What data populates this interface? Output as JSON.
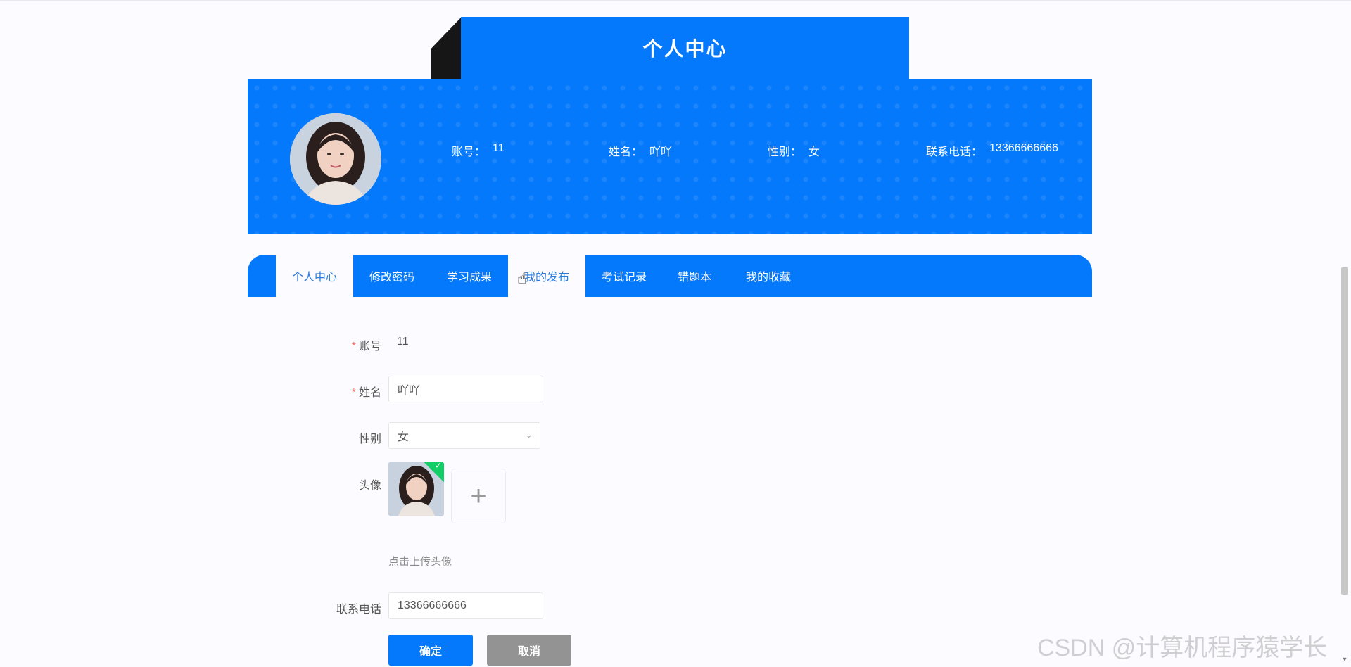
{
  "page": {
    "title": "个人中心"
  },
  "profile": {
    "items": [
      {
        "key": "账号：",
        "value": "11"
      },
      {
        "key": "姓名：",
        "value": "吖吖"
      },
      {
        "key": "性别：",
        "value": "女"
      },
      {
        "key": "联系电话：",
        "value": "13366666666"
      }
    ]
  },
  "tabs": [
    "个人中心",
    "修改密码",
    "学习成果",
    "我的发布",
    "考试记录",
    "错题本",
    "我的收藏"
  ],
  "form": {
    "account": {
      "label": "账号",
      "value": "11"
    },
    "name": {
      "label": "姓名",
      "value": "吖吖"
    },
    "gender": {
      "label": "性别",
      "value": "女"
    },
    "avatar": {
      "label": "头像",
      "tip": "点击上传头像"
    },
    "phone": {
      "label": "联系电话",
      "value": "13366666666"
    },
    "required_mark": "*",
    "confirm": "确定",
    "cancel": "取消"
  },
  "watermark": "CSDN @计算机程序猿学长",
  "icons": {
    "upload": "plus-icon",
    "select": "chevron-down-icon",
    "check": "check-icon",
    "cursor": "hand-cursor-icon"
  }
}
